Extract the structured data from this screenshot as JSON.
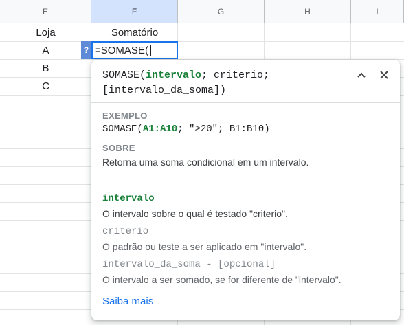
{
  "sheet": {
    "columns": [
      {
        "label": "E"
      },
      {
        "label": "F"
      },
      {
        "label": "G"
      },
      {
        "label": "H"
      },
      {
        "label": "I"
      }
    ],
    "cells": {
      "header_e": "Loja",
      "header_f": "Somatório",
      "rows": [
        "A",
        "B",
        "C"
      ]
    },
    "editor": {
      "formula": "=SOMASE("
    },
    "help_button": "?"
  },
  "popup": {
    "signature": {
      "fn": "SOMASE(",
      "arg1": "intervalo",
      "rest1": "; criterio;",
      "line2": "[intervalo_da_soma])"
    },
    "collapse_icon": "chevron-up-icon",
    "close_icon": "close-icon",
    "example_label": "EXEMPLO",
    "example": {
      "pre": "SOMASE(",
      "arg": "A1:A10",
      "post": "; \">20\"; B1:B10)"
    },
    "about_label": "SOBRE",
    "about_text": "Retorna uma soma condicional em um intervalo.",
    "args": [
      {
        "name": "intervalo",
        "desc": "O intervalo sobre o qual é testado \"criterio\"."
      },
      {
        "name": "criterio",
        "desc": "O padrão ou teste a ser aplicado em \"intervalo\"."
      },
      {
        "name": "intervalo_da_soma - [opcional]",
        "desc": "O intervalo a ser somado, se for diferente de \"intervalo\"."
      }
    ],
    "learn_more": "Saiba mais"
  },
  "colors": {
    "accent": "#1a73e8",
    "argument_highlight": "#188038",
    "help_button": "#5f8ad8",
    "active_column_header": "#d3e3fd"
  }
}
